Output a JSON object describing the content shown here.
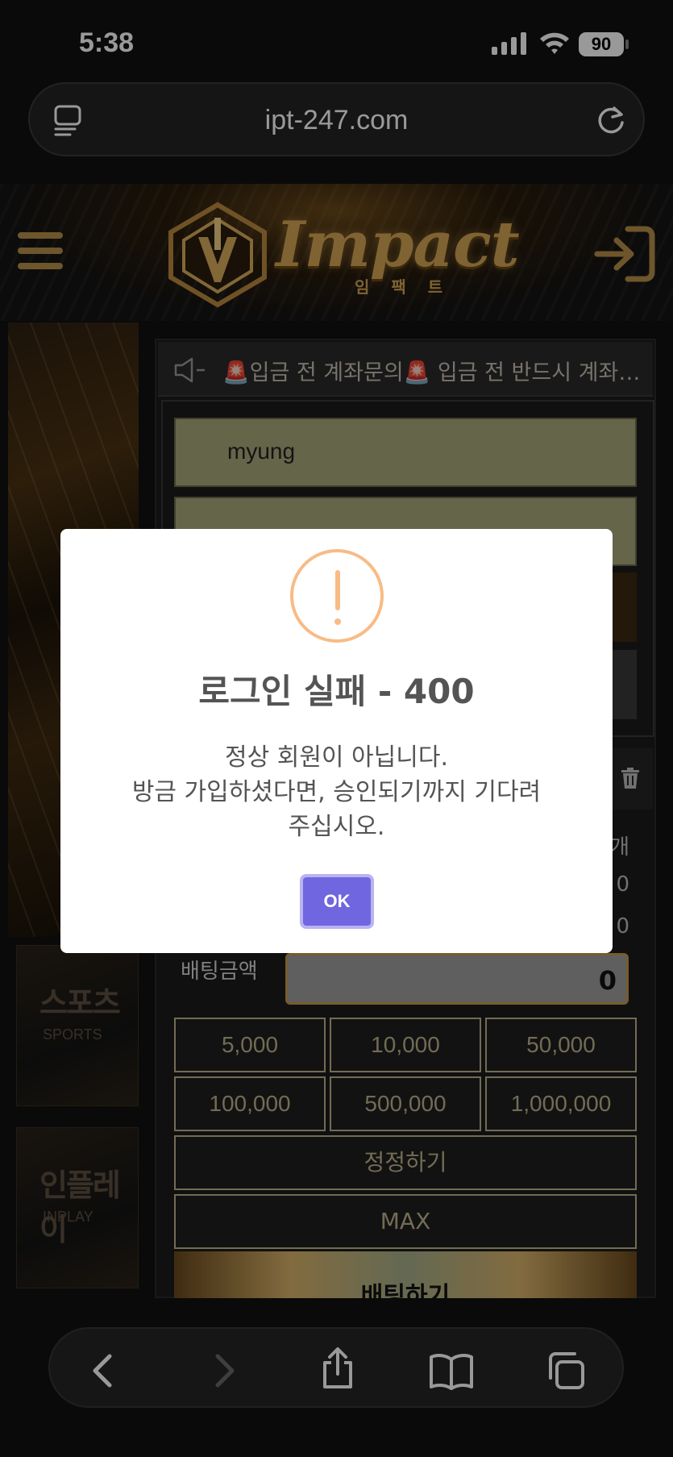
{
  "status_bar": {
    "time": "5:38",
    "battery": "90"
  },
  "browser": {
    "url": "ipt-247.com"
  },
  "site": {
    "logo_text": "Impact",
    "logo_sub": "임 팩 트",
    "notice_text": "🚨입금 전 계좌문의🚨 입금 전 반드시 계좌문…",
    "login": {
      "username": "myung",
      "password_mask": "●●●●"
    },
    "side_cards": [
      {
        "big": "스포츠",
        "small": "SPORTS"
      },
      {
        "big": "인플레이",
        "small": "INPLAY"
      }
    ],
    "slip_rows": [
      "개",
      "0",
      "0"
    ],
    "bet_amount_label": "배팅금액",
    "bet_amount_value": "0",
    "chips": [
      "5,000",
      "10,000",
      "50,000",
      "100,000",
      "500,000",
      "1,000,000"
    ],
    "reset_label": "정정하기",
    "max_label": "MAX",
    "bet_submit_label": "배팅하기"
  },
  "modal": {
    "title": "로그인 실패 - 400",
    "message_lines": [
      "정상 회원이 아닙니다.",
      "방금 가입하셨다면, 승인되기까지 기다려",
      "주십시오."
    ],
    "ok_label": "OK"
  },
  "colors": {
    "accent_gold": "#d4a655",
    "modal_button": "#7066e0",
    "warning": "#f8bb86"
  }
}
